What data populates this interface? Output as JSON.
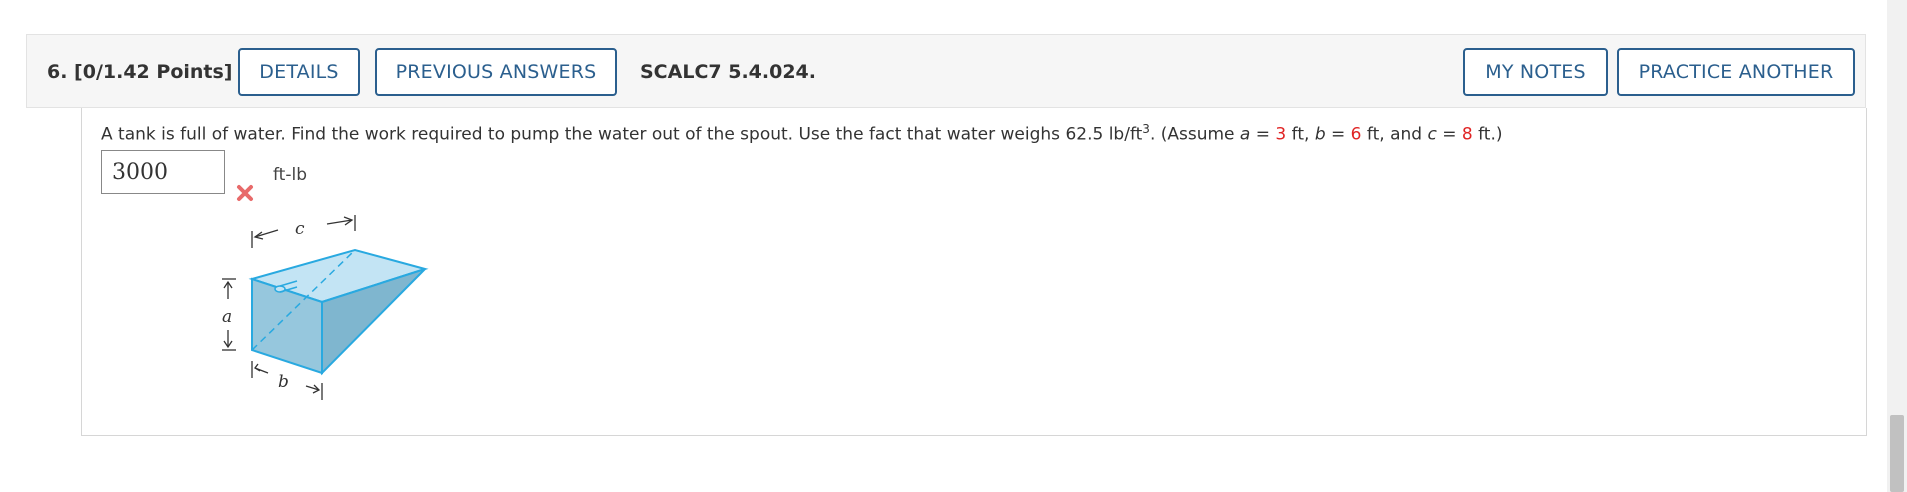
{
  "question": {
    "number_points": "6.  [0/1.42 Points]",
    "details_label": "DETAILS",
    "previous_answers_label": "PREVIOUS ANSWERS",
    "code": "SCALC7 5.4.024.",
    "my_notes_label": "MY NOTES",
    "practice_another_label": "PRACTICE ANOTHER"
  },
  "prompt": {
    "text_before": "A tank is full of water. Find the work required to pump the water out of the spout. Use the fact that water weighs 62.5 lb/ft",
    "superscript": "3",
    "text_assume": ". (Assume ",
    "var_a": "a",
    "eq1": " = ",
    "val_a": "3",
    "unit_a": " ft, ",
    "var_b": "b",
    "eq2": " = ",
    "val_b": "6",
    "unit_b": " ft, and ",
    "var_c": "c",
    "eq3": " = ",
    "val_c": "8",
    "unit_c": " ft.)"
  },
  "answer": {
    "value": "3000",
    "units": "ft-lb",
    "status_icon": "x-mark-icon"
  },
  "figure": {
    "label_a": "a",
    "label_b": "b",
    "label_c": "c"
  },
  "colors": {
    "accent": "#2b5f8e",
    "error": "#e02424",
    "tank_fill": "#a8d8ee",
    "tank_stroke": "#29a9e0"
  }
}
